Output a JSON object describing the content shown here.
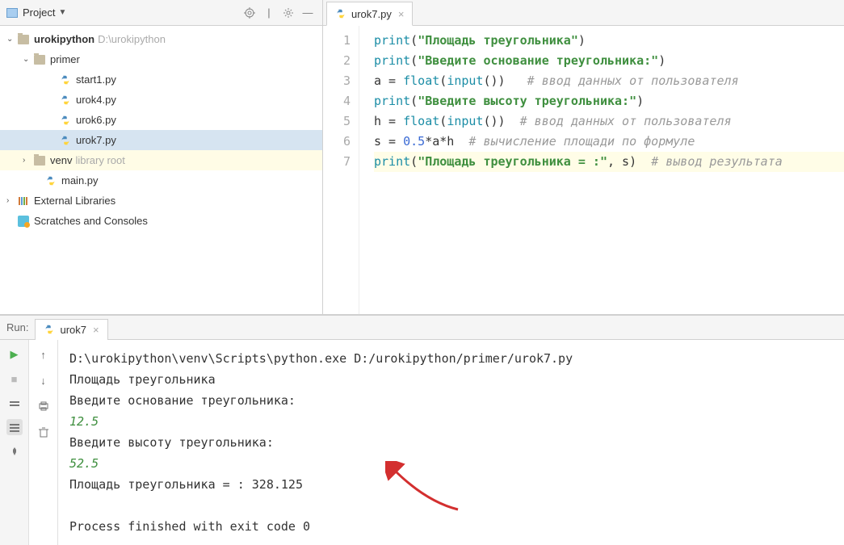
{
  "sidebar": {
    "title": "Project",
    "root": {
      "name": "urokipython",
      "path": "D:\\urokipython"
    },
    "primer": "primer",
    "files": [
      "start1.py",
      "urok4.py",
      "urok6.py",
      "urok7.py"
    ],
    "venv": {
      "name": "venv",
      "extra": "library root"
    },
    "main": "main.py",
    "extlib": "External Libraries",
    "scratch": "Scratches and Consoles"
  },
  "editor": {
    "tab": "urok7.py",
    "lines": [
      "1",
      "2",
      "3",
      "4",
      "5",
      "6",
      "7"
    ],
    "code": {
      "l1": {
        "kw": "print",
        "str": "\"Площадь треугольника\""
      },
      "l2": {
        "kw": "print",
        "str": "\"Введите основание треугольника:\""
      },
      "l3": {
        "v": "a = ",
        "fn": "float",
        "fn2": "input",
        "cmt": "# ввод данных от пользователя"
      },
      "l4": {
        "kw": "print",
        "str": "\"Введите высоту треугольника:\""
      },
      "l5": {
        "v": "h = ",
        "fn": "float",
        "fn2": "input",
        "cmt": "# ввод данных от пользователя"
      },
      "l6": {
        "v": "s = ",
        "num": "0.5",
        "rest": "*a*h  ",
        "cmt": "# вычисление площади по формуле"
      },
      "l7": {
        "kw": "print",
        "str": "\"Площадь треугольника = :\"",
        "arg": ", s",
        "cmt": "# вывод результата"
      }
    }
  },
  "run": {
    "label": "Run:",
    "tab": "urok7",
    "path": "D:\\urokipython\\venv\\Scripts\\python.exe D:/urokipython/primer/urok7.py",
    "out1": "Площадь треугольника",
    "out2": "Введите основание треугольника:",
    "in1": "12.5",
    "out3": "Введите высоту треугольника:",
    "in2": "52.5",
    "out4": "Площадь треугольника = : 328.125",
    "exit": "Process finished with exit code 0"
  }
}
